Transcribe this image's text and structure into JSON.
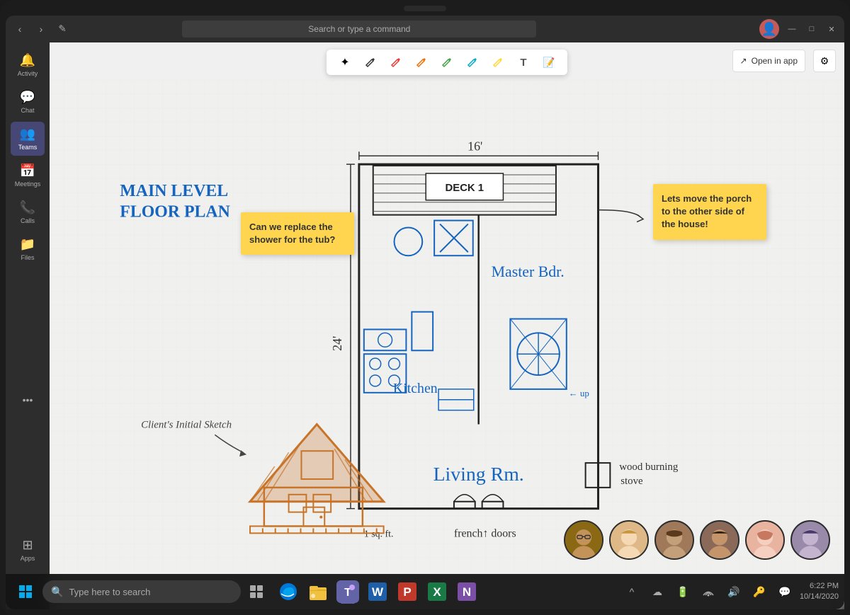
{
  "app": {
    "title": "Microsoft Teams",
    "camera_notch": true
  },
  "titlebar": {
    "search_placeholder": "Search or type a command",
    "nav_back": "‹",
    "nav_forward": "›",
    "edit_icon": "✏",
    "minimize": "—",
    "maximize": "□",
    "close": "✕"
  },
  "sidebar": {
    "items": [
      {
        "id": "activity",
        "label": "Activity",
        "icon": "🔔"
      },
      {
        "id": "chat",
        "label": "Chat",
        "icon": "💬"
      },
      {
        "id": "teams",
        "label": "Teams",
        "icon": "👥",
        "active": true
      },
      {
        "id": "meetings",
        "label": "Meetings",
        "icon": "📅"
      },
      {
        "id": "calls",
        "label": "Calls",
        "icon": "📞"
      },
      {
        "id": "files",
        "label": "Files",
        "icon": "📁"
      },
      {
        "id": "more",
        "label": "...",
        "icon": "···"
      }
    ]
  },
  "whiteboard": {
    "title_line1": "MAIN LEVEL",
    "title_line2": "FLOOR PLAN",
    "dimension_16": "16'",
    "dimension_24": "24'",
    "deck_label": "DECK 1",
    "master_bdr_label": "Master Bdr.",
    "kitchen_label": "Kitchen",
    "living_rm_label": "Living Rm.",
    "french_doors_label": "french doors",
    "sqft_label": "1 sq. ft.",
    "up_label": "up",
    "wood_burning_label": "wood burning stove",
    "sketch_caption": "Client's Initial Sketch",
    "sticky_note_1": "Can we replace the shower for the tub?",
    "sticky_note_2": "Lets move the porch to the other side of the house!"
  },
  "toolbar": {
    "tools": [
      {
        "id": "select",
        "icon": "✦",
        "label": "Select"
      },
      {
        "id": "pen-dark",
        "icon": "✒",
        "label": "Dark pen"
      },
      {
        "id": "pen-red",
        "icon": "✒",
        "label": "Red pen"
      },
      {
        "id": "pen-coral",
        "icon": "✒",
        "label": "Coral pen"
      },
      {
        "id": "pen-green",
        "icon": "✒",
        "label": "Green pen"
      },
      {
        "id": "pen-teal",
        "icon": "✒",
        "label": "Teal pen"
      },
      {
        "id": "pen-blue",
        "icon": "✒",
        "label": "Blue pen"
      },
      {
        "id": "pen-yellow",
        "icon": "✒",
        "label": "Yellow pen"
      },
      {
        "id": "text",
        "icon": "T",
        "label": "Text"
      },
      {
        "id": "sticky",
        "icon": "📝",
        "label": "Sticky note"
      }
    ],
    "open_in_app": "Open in app",
    "settings_icon": "⚙"
  },
  "participants": [
    {
      "id": "p1",
      "initials": "👨",
      "color": "#8B6914"
    },
    {
      "id": "p2",
      "initials": "👩",
      "color": "#c4a35a"
    },
    {
      "id": "p3",
      "initials": "👨",
      "color": "#6b4c3b"
    },
    {
      "id": "p4",
      "initials": "👨",
      "color": "#3a5a8a"
    },
    {
      "id": "p5",
      "initials": "👩",
      "color": "#c4735a"
    },
    {
      "id": "p6",
      "initials": "👩",
      "color": "#4a3a5a"
    }
  ],
  "taskbar": {
    "search_placeholder": "Type here to search",
    "apps": [
      {
        "id": "edge",
        "label": "Microsoft Edge",
        "icon": "🌐"
      },
      {
        "id": "explorer",
        "label": "File Explorer",
        "icon": "📁"
      },
      {
        "id": "teams",
        "label": "Microsoft Teams",
        "icon": "T",
        "active": true,
        "color": "#6264a7"
      },
      {
        "id": "word",
        "label": "Microsoft Word",
        "icon": "W",
        "color": "#1e5fa8"
      },
      {
        "id": "powerpoint",
        "label": "PowerPoint",
        "icon": "P",
        "color": "#c0392b"
      },
      {
        "id": "excel",
        "label": "Excel",
        "icon": "X",
        "color": "#1a7a45"
      },
      {
        "id": "onenote",
        "label": "OneNote",
        "icon": "N",
        "color": "#7b4fa6"
      }
    ],
    "system_icons": [
      "^",
      "☁",
      "🔋",
      "📶",
      "🔊",
      "🔑",
      "💬"
    ],
    "time": "6:22 PM",
    "date": "10/14/2020"
  }
}
